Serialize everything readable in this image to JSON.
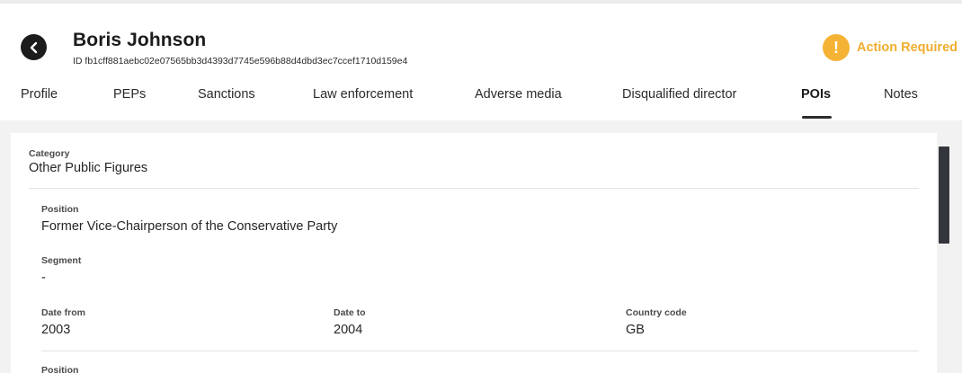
{
  "header": {
    "name": "Boris Johnson",
    "id_text": "ID fb1cff881aebc02e07565bb3d4393d7745e596b88d4dbd3ec7ccef1710d159e4",
    "status_icon": "!",
    "status_label": "Action Required",
    "status_color": "#f5b335"
  },
  "tabs": [
    {
      "label": "Profile"
    },
    {
      "label": "PEPs"
    },
    {
      "label": "Sanctions"
    },
    {
      "label": "Law enforcement"
    },
    {
      "label": "Adverse media"
    },
    {
      "label": "Disqualified director"
    },
    {
      "label": "POIs",
      "active": true
    },
    {
      "label": "Notes"
    }
  ],
  "details": {
    "category_label": "Category",
    "category_value": "Other Public Figures",
    "position_label": "Position",
    "position_value": "Former Vice-Chairperson of the Conservative Party",
    "segment_label": "Segment",
    "segment_value": "-",
    "date_from_label": "Date from",
    "date_from_value": "2003",
    "date_to_label": "Date to",
    "date_to_value": "2004",
    "country_code_label": "Country code",
    "country_code_value": "GB",
    "next_position_label": "Position"
  },
  "icons": {
    "back": "back-arrow-icon",
    "status": "exclamation-icon"
  }
}
